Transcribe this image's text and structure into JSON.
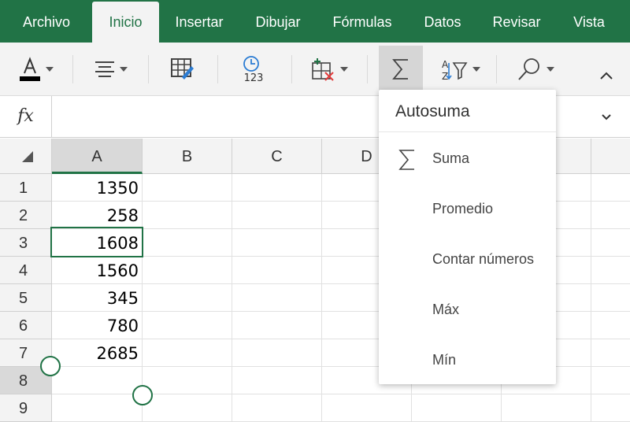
{
  "ribbon": {
    "tabs": [
      {
        "label": "Archivo"
      },
      {
        "label": "Inicio"
      },
      {
        "label": "Insertar"
      },
      {
        "label": "Dibujar"
      },
      {
        "label": "Fórmulas"
      },
      {
        "label": "Datos"
      },
      {
        "label": "Revisar"
      },
      {
        "label": "Vista"
      }
    ],
    "active_tab": "Inicio"
  },
  "toolbar": {
    "number_format_icon_text": "123",
    "sort_icon_text": "A Z",
    "font_color": "#000000"
  },
  "formula_bar": {
    "fx_label": "fx",
    "value": ""
  },
  "grid": {
    "columns": [
      "A",
      "B",
      "C",
      "D",
      "",
      "",
      ""
    ],
    "rows": [
      {
        "num": "1",
        "a": "1350"
      },
      {
        "num": "2",
        "a": "258"
      },
      {
        "num": "3",
        "a": "1608"
      },
      {
        "num": "4",
        "a": "1560"
      },
      {
        "num": "5",
        "a": "345"
      },
      {
        "num": "6",
        "a": "780"
      },
      {
        "num": "7",
        "a": "2685"
      },
      {
        "num": "8",
        "a": ""
      },
      {
        "num": "9",
        "a": ""
      }
    ],
    "selected_column": "A",
    "selected_row": "8"
  },
  "autosum_menu": {
    "title": "Autosuma",
    "items": [
      {
        "label": "Suma",
        "icon": "sigma-icon"
      },
      {
        "label": "Promedio"
      },
      {
        "label": "Contar números"
      },
      {
        "label": "Máx"
      },
      {
        "label": "Mín"
      }
    ]
  },
  "colors": {
    "brand": "#217346",
    "toolbar_bg": "#f3f3f3",
    "pressed_bg": "#d6d6d6",
    "delete_red": "#e23a3a",
    "accent_blue": "#2b7cd3"
  }
}
